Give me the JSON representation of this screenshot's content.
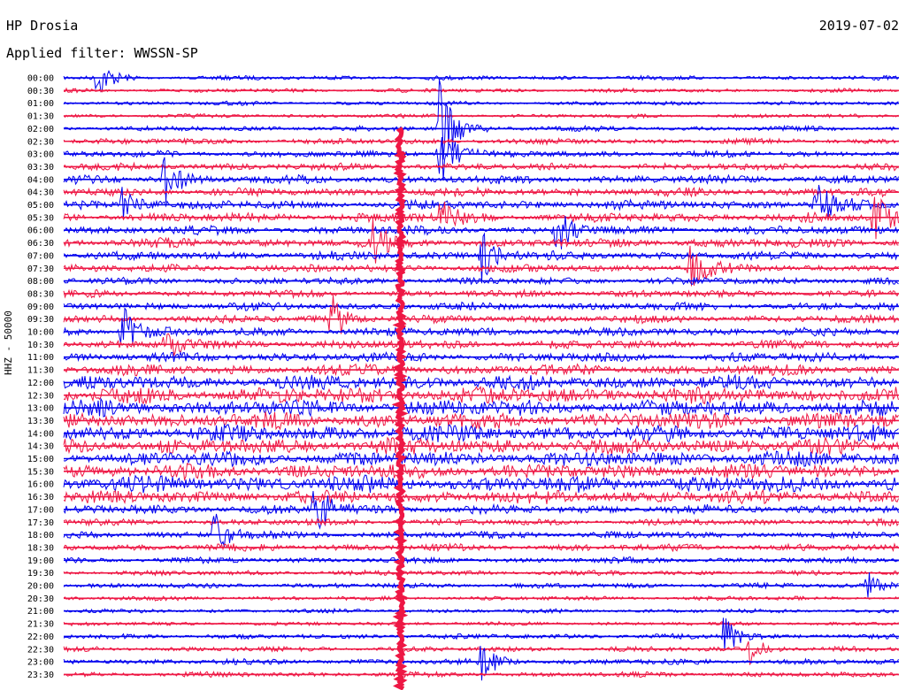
{
  "header": {
    "station": "HP Drosia",
    "date": "2019-07-02",
    "filter_label": "Applied filter: WWSSN-SP"
  },
  "y_axis_label": "HHZ - 50000",
  "chart_data": {
    "type": "line",
    "title": "HP Drosia",
    "date": "2019-07-02",
    "filter": "WWSSN-SP",
    "ylabel": "HHZ - 50000",
    "trace_colors": [
      "#0000ee",
      "#ee1744"
    ],
    "rows": [
      {
        "time": "00:00",
        "activity": 0.15
      },
      {
        "time": "00:30",
        "activity": 0.12
      },
      {
        "time": "01:00",
        "activity": 0.12
      },
      {
        "time": "01:30",
        "activity": 0.12
      },
      {
        "time": "02:00",
        "activity": 0.2
      },
      {
        "time": "02:30",
        "activity": 0.25
      },
      {
        "time": "03:00",
        "activity": 0.3
      },
      {
        "time": "03:30",
        "activity": 0.35
      },
      {
        "time": "04:00",
        "activity": 0.45
      },
      {
        "time": "04:30",
        "activity": 0.45
      },
      {
        "time": "05:00",
        "activity": 0.5
      },
      {
        "time": "05:30",
        "activity": 0.5
      },
      {
        "time": "06:00",
        "activity": 0.45
      },
      {
        "time": "06:30",
        "activity": 0.5
      },
      {
        "time": "07:00",
        "activity": 0.45
      },
      {
        "time": "07:30",
        "activity": 0.4
      },
      {
        "time": "08:00",
        "activity": 0.35
      },
      {
        "time": "08:30",
        "activity": 0.35
      },
      {
        "time": "09:00",
        "activity": 0.4
      },
      {
        "time": "09:30",
        "activity": 0.4
      },
      {
        "time": "10:00",
        "activity": 0.45
      },
      {
        "time": "10:30",
        "activity": 0.45
      },
      {
        "time": "11:00",
        "activity": 0.5
      },
      {
        "time": "11:30",
        "activity": 0.6
      },
      {
        "time": "12:00",
        "activity": 0.85
      },
      {
        "time": "12:30",
        "activity": 1.0
      },
      {
        "time": "13:00",
        "activity": 1.0
      },
      {
        "time": "13:30",
        "activity": 1.0
      },
      {
        "time": "14:00",
        "activity": 1.0
      },
      {
        "time": "14:30",
        "activity": 1.0
      },
      {
        "time": "15:00",
        "activity": 0.9
      },
      {
        "time": "15:30",
        "activity": 0.9
      },
      {
        "time": "16:00",
        "activity": 1.0
      },
      {
        "time": "16:30",
        "activity": 0.8
      },
      {
        "time": "17:00",
        "activity": 0.5
      },
      {
        "time": "17:30",
        "activity": 0.3
      },
      {
        "time": "18:00",
        "activity": 0.35
      },
      {
        "time": "18:30",
        "activity": 0.35
      },
      {
        "time": "19:00",
        "activity": 0.25
      },
      {
        "time": "19:30",
        "activity": 0.2
      },
      {
        "time": "20:00",
        "activity": 0.2
      },
      {
        "time": "20:30",
        "activity": 0.15
      },
      {
        "time": "21:00",
        "activity": 0.12
      },
      {
        "time": "21:30",
        "activity": 0.12
      },
      {
        "time": "22:00",
        "activity": 0.2
      },
      {
        "time": "22:30",
        "activity": 0.2
      },
      {
        "time": "23:00",
        "activity": 0.25
      },
      {
        "time": "23:30",
        "activity": 0.2
      }
    ],
    "events": [
      {
        "time": "00:00",
        "x_frac": 0.04,
        "amplitude": 1.0
      },
      {
        "time": "02:00",
        "x_frac": 0.45,
        "amplitude": 3.0
      },
      {
        "time": "03:00",
        "x_frac": 0.45,
        "amplitude": 2.0
      },
      {
        "time": "04:00",
        "x_frac": 0.12,
        "amplitude": 1.5
      },
      {
        "time": "05:00",
        "x_frac": 0.07,
        "amplitude": 1.2
      },
      {
        "time": "05:00",
        "x_frac": 0.9,
        "amplitude": 1.2
      },
      {
        "time": "05:30",
        "x_frac": 0.97,
        "amplitude": 1.6
      },
      {
        "time": "06:00",
        "x_frac": 0.59,
        "amplitude": 1.2
      },
      {
        "time": "06:30",
        "x_frac": 0.37,
        "amplitude": 1.0
      },
      {
        "time": "07:00",
        "x_frac": 0.5,
        "amplitude": 1.4
      },
      {
        "time": "07:30",
        "x_frac": 0.75,
        "amplitude": 1.4
      },
      {
        "time": "09:30",
        "x_frac": 0.32,
        "amplitude": 1.6
      },
      {
        "time": "10:00",
        "x_frac": 0.07,
        "amplitude": 1.5
      },
      {
        "time": "10:30",
        "x_frac": 0.12,
        "amplitude": 1.0
      },
      {
        "time": "17:00",
        "x_frac": 0.3,
        "amplitude": 1.6
      },
      {
        "time": "18:00",
        "x_frac": 0.18,
        "amplitude": 1.2
      },
      {
        "time": "20:00",
        "x_frac": 0.96,
        "amplitude": 0.8
      },
      {
        "time": "22:00",
        "x_frac": 0.79,
        "amplitude": 1.1
      },
      {
        "time": "22:30",
        "x_frac": 0.82,
        "amplitude": 0.8
      },
      {
        "time": "23:00",
        "x_frac": 0.5,
        "amplitude": 1.0
      },
      {
        "time": "05:30",
        "x_frac": 0.45,
        "amplitude": 1.0
      }
    ],
    "long_spike": {
      "x_frac": 0.403,
      "from_time": "02:00",
      "to_time": "23:30"
    },
    "grid": false,
    "legend": "none"
  }
}
